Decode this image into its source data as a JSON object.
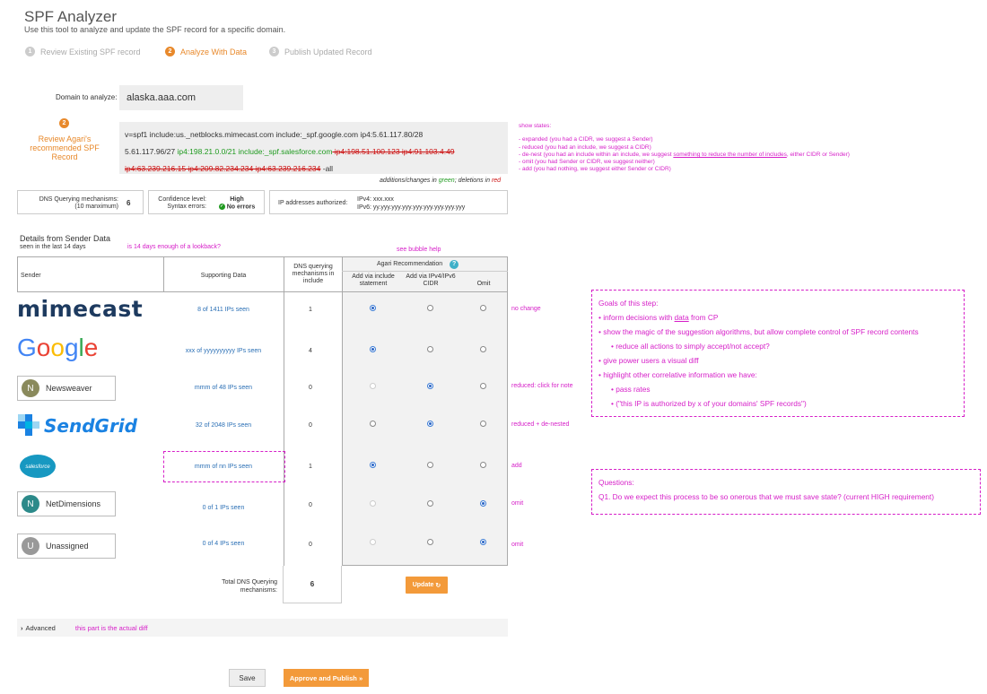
{
  "header": {
    "title": "SPF Analyzer",
    "subtitle": "Use this tool to analyze and update the SPF record for a specific domain."
  },
  "steps": [
    {
      "num": "1",
      "label": "Review Existing SPF record"
    },
    {
      "num": "2",
      "label": "Analyze With Data"
    },
    {
      "num": "3",
      "label": "Publish Updated Record"
    }
  ],
  "domain": {
    "label": "Domain to analyze:",
    "value": "alaska.aaa.com"
  },
  "recommendation": {
    "num": "2",
    "label": "Review Agari's recommended SPF Record",
    "line1": "v=spf1 include:us._netblocks.mimecast.com include:_spf.google.com ip4:5.61.117.80/28",
    "line2_plain": "5.61.117.96/27 ",
    "line2_green": "ip4:198.21.0.0/21 include:_spf.salesforce.com",
    "line2_red": " ip4:198.51.100.123 ip4:91.103.4.49",
    "line3_red": "ip4:63.239.216.15 ip4:209.82.234.234 ip4:63.239.216.234",
    "line3_plain": " -all",
    "note_prefix": "additions/changes in ",
    "note_green": "green",
    "note_mid": "; deletions in ",
    "note_red": "red"
  },
  "states_note": {
    "title": "show states:",
    "lines": [
      "- expanded (you had a CIDR, we suggest a Sender)",
      "- reduced (you had an include, we suggest a CIDR)",
      "- omit (you had Sender or CIDR, we suggest neither)",
      "- add (you had nothing, we suggest either Sender or CIDR)"
    ],
    "denest_prefix": "- de-nest (you had an include within an include, we suggest ",
    "denest_link": "something to reduce the number of includes",
    "denest_suffix": ", either CIDR or Sender)"
  },
  "summary": {
    "dns_label1": "DNS Querying mechanisms:",
    "dns_label2": "(10 manximum)",
    "dns_value": "6",
    "confidence_label": "Confidence level:",
    "confidence_value": "High",
    "syntax_label": "Syntax errors:",
    "syntax_value": "No errors",
    "ip_label": "IP addresses authorized:",
    "ipv4": "IPv4: xxx.xxx",
    "ipv6": "IPv6: yy.yyy.yyy.yyy.yyy.yyy.yyy.yyy.yyy"
  },
  "details": {
    "title": "Details from Sender Data",
    "sub": "seen in the last 14 days",
    "lookback_note": "is 14 days enough of a lookback?",
    "bubble_note": "see bubble help"
  },
  "table": {
    "col_sender": "Sender",
    "col_support": "Supporting Data",
    "col_dns": "DNS querying mechanisms in include",
    "agari_header": "Agari Recommendation",
    "help_icon": "?",
    "col_add_include": "Add via include statement",
    "col_add_cidr": "Add via IPv4/IPv6 CIDR",
    "col_omit": "Omit",
    "rows": [
      {
        "sender": "mimecast",
        "support": "8 of 1411 IPs seen",
        "count": "1",
        "note": "no change"
      },
      {
        "sender": "Google",
        "support": "xxx of yyyyyyyyyy IPs seen",
        "count": "4",
        "note": ""
      },
      {
        "sender": "Newsweaver",
        "initial": "N",
        "support": "mmm of 48 IPs seen",
        "count": "0",
        "note": "reduced: click for note"
      },
      {
        "sender": "SendGrid",
        "support": "32 of 2048 IPs seen",
        "count": "0",
        "note": "reduced + de-nested"
      },
      {
        "sender": "salesforce",
        "support": "mmm of nn IPs seen",
        "count": "1",
        "note": "add"
      },
      {
        "sender": "NetDimensions",
        "initial": "N",
        "support": "0 of 1 IPs seen",
        "count": "0",
        "note": "omit"
      },
      {
        "sender": "Unassigned",
        "initial": "U",
        "support": "0 of 4 IPs seen",
        "count": "0",
        "note": "omit"
      }
    ],
    "total_label": "Total DNS Querying mechanisms:",
    "total_value": "6",
    "update_label": "Update"
  },
  "goals": {
    "title": "Goals of this step:",
    "l1_prefix": "• inform decisions with ",
    "l1_link": "data",
    "l1_suffix": " from CP",
    "l2": "• show the magic of the suggestion algorithms, but allow complete control of SPF record contents",
    "l3": "• reduce all actions to simply accept/not accept?",
    "l4": "• give power users a visual diff",
    "l5": "• highlight other correlative information we have:",
    "l6": "• pass rates",
    "l7": "• (\"this IP is authorized by x of your domains' SPF records\")"
  },
  "questions": {
    "title": "Questions:",
    "q1": "Q1. Do we expect this process to be so onerous that we must save state? (current HIGH requirement)"
  },
  "advanced": {
    "label": "Advanced",
    "note": "this part is the actual diff"
  },
  "footer": {
    "save": "Save",
    "approve": "Approve and Publish »"
  },
  "colors": {
    "accent": "#e8892b",
    "annotation": "#d61fc8",
    "link": "#2a6fb5",
    "mimecast": "#1d3a5f",
    "sendgrid": "#1a82e2",
    "salesforce": "#1798c1"
  }
}
